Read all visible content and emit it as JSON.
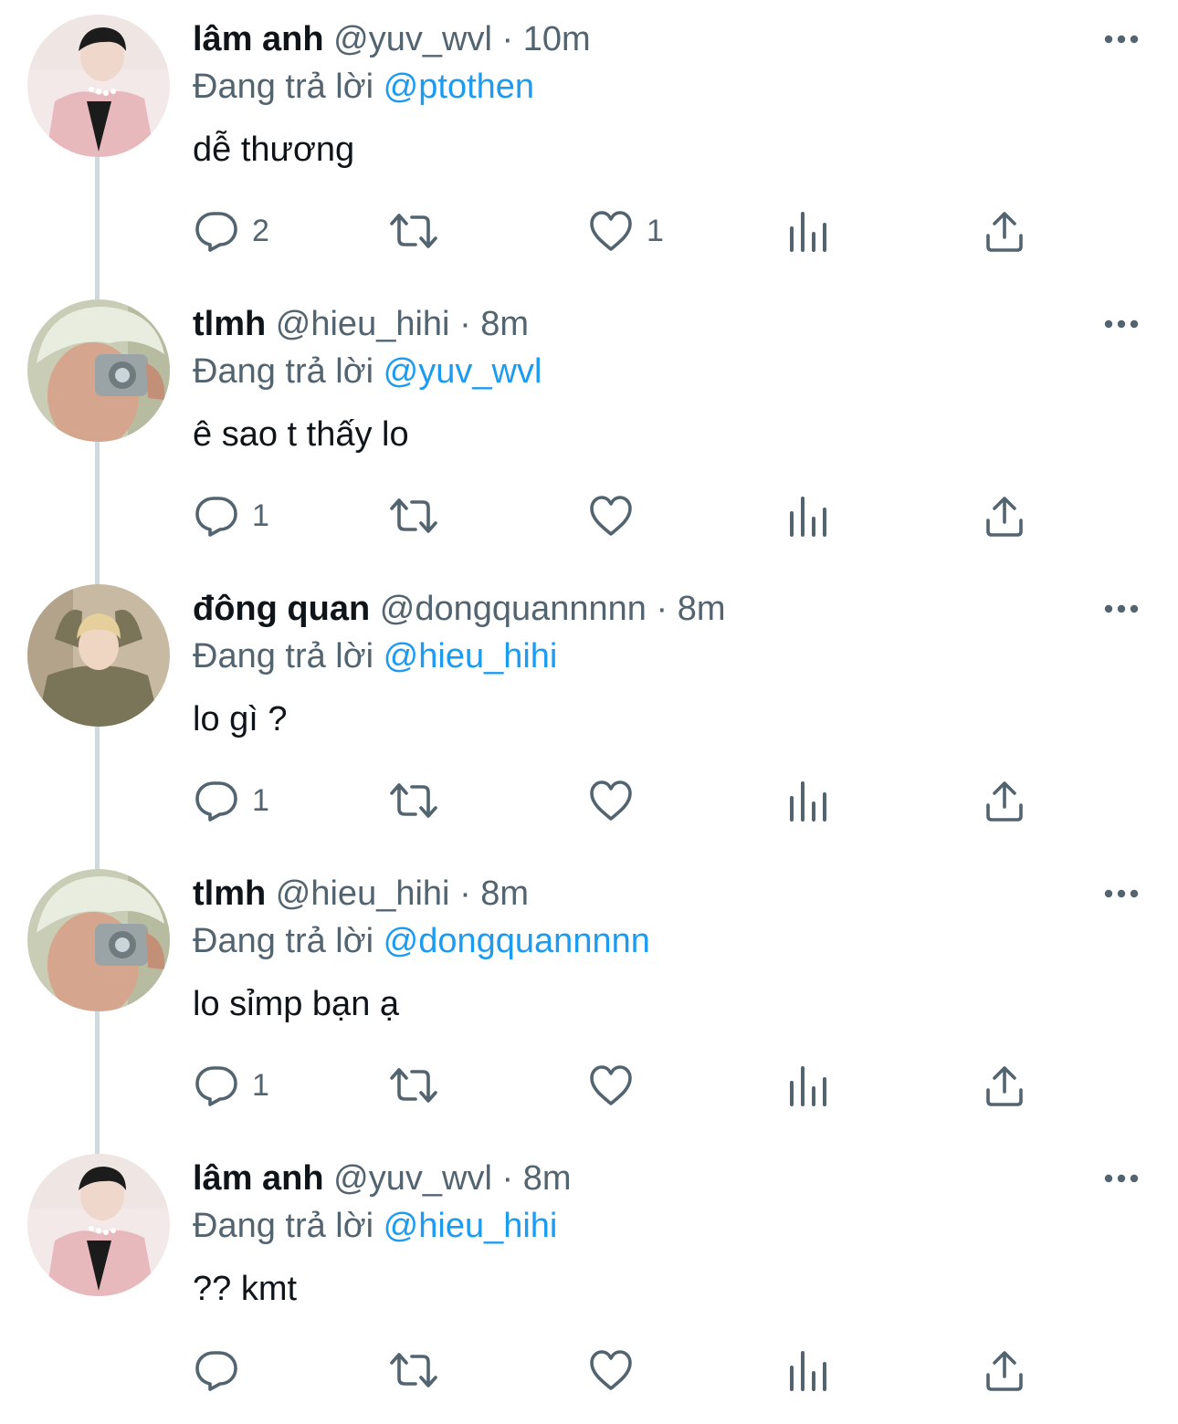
{
  "reply_prefix": "Đang trả lời",
  "colors": {
    "text": "#0f1419",
    "secondary": "#536471",
    "accent": "#1d9bf0",
    "thread_line": "#cfd9de"
  },
  "tweets": [
    {
      "name": "lâm anh",
      "handle": "@yuv_wvl",
      "time": "10m",
      "reply_to": "@ptothen",
      "text": "dễ thương",
      "replies": "2",
      "retweets": "",
      "likes": "1",
      "avatar": "avatar-lam-anh"
    },
    {
      "name": "tlmh",
      "handle": "@hieu_hihi",
      "time": "8m",
      "reply_to": "@yuv_wvl",
      "text": "ê sao t thấy lo",
      "replies": "1",
      "retweets": "",
      "likes": "",
      "avatar": "avatar-tlmh"
    },
    {
      "name": "đông quan",
      "handle": "@dongquannnnn",
      "time": "8m",
      "reply_to": "@hieu_hihi",
      "text": "lo gì ?",
      "replies": "1",
      "retweets": "",
      "likes": "",
      "avatar": "avatar-dong-quan"
    },
    {
      "name": "tlmh",
      "handle": "@hieu_hihi",
      "time": "8m",
      "reply_to": "@dongquannnnn",
      "text": "lo sỉmp bạn ạ",
      "replies": "1",
      "retweets": "",
      "likes": "",
      "avatar": "avatar-tlmh"
    },
    {
      "name": "lâm anh",
      "handle": "@yuv_wvl",
      "time": "8m",
      "reply_to": "@hieu_hihi",
      "text": "?? kmt",
      "replies": "",
      "retweets": "",
      "likes": "",
      "avatar": "avatar-lam-anh"
    }
  ],
  "icons": [
    "more-icon",
    "reply-icon",
    "retweet-icon",
    "like-icon",
    "views-icon",
    "share-icon"
  ]
}
